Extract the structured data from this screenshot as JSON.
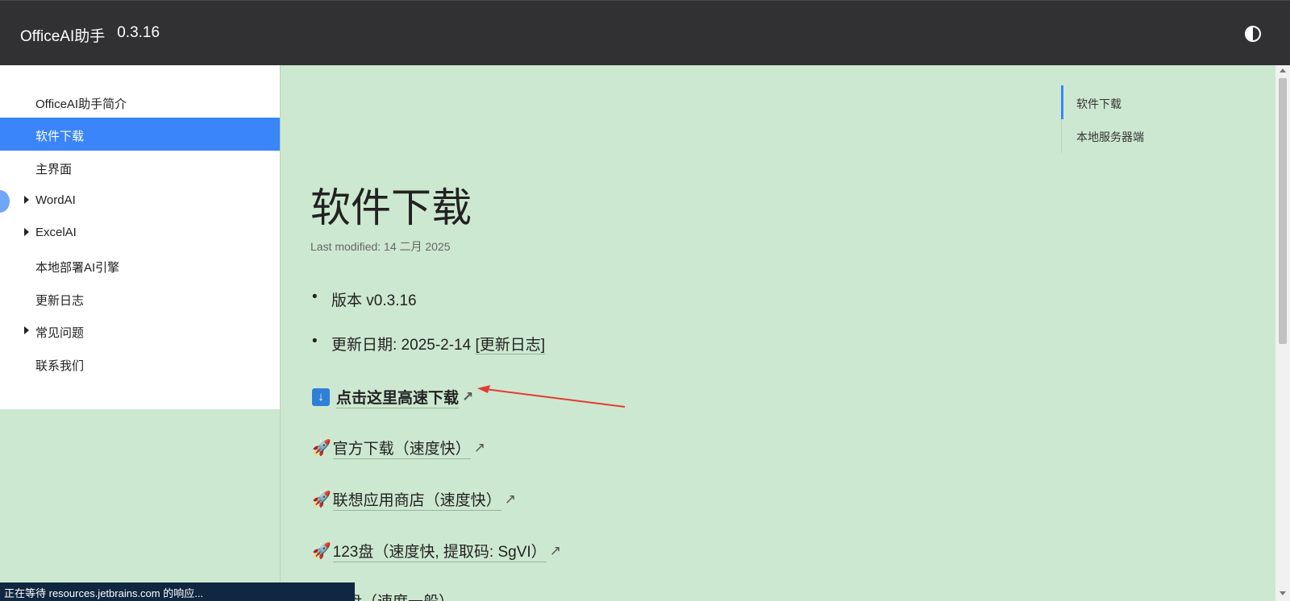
{
  "header": {
    "title": "OfficeAI助手",
    "version": "0.3.16",
    "theme_icon": "contrast-icon"
  },
  "sidebar": {
    "items": [
      {
        "label": "OfficeAI助手简介",
        "expandable": false,
        "active": false
      },
      {
        "label": "软件下载",
        "expandable": false,
        "active": true
      },
      {
        "label": "主界面",
        "expandable": false,
        "active": false
      },
      {
        "label": "WordAI",
        "expandable": true,
        "active": false
      },
      {
        "label": "ExcelAI",
        "expandable": true,
        "active": false
      },
      {
        "label": "本地部署AI引擎",
        "expandable": false,
        "active": false
      },
      {
        "label": "更新日志",
        "expandable": false,
        "active": false
      },
      {
        "label": "常见问题",
        "expandable": true,
        "active": false
      },
      {
        "label": "联系我们",
        "expandable": false,
        "active": false
      }
    ]
  },
  "toc": {
    "items": [
      "软件下载",
      "本地服务器端"
    ]
  },
  "main": {
    "title": "软件下载",
    "last_modified": "Last modified: 14 二月 2025",
    "version_line": "版本 v0.3.16",
    "update_prefix": "更新日期: 2025-2-14 ",
    "changelog_link": "[更新日志]",
    "download_main": "点击这里高速下载",
    "download_links": [
      "官方下载（速度快）",
      "联想应用商店（速度快）",
      "123盘（速度快, 提取码: SgVI）"
    ],
    "partial_text": "盘（速度一般）"
  },
  "status": {
    "text": "正在等待 resources.jetbrains.com 的响应..."
  },
  "colors": {
    "accent": "#3a85f9",
    "topbar": "#313133",
    "content_bg": "#cde8d0",
    "annotation_arrow": "#e53935"
  }
}
